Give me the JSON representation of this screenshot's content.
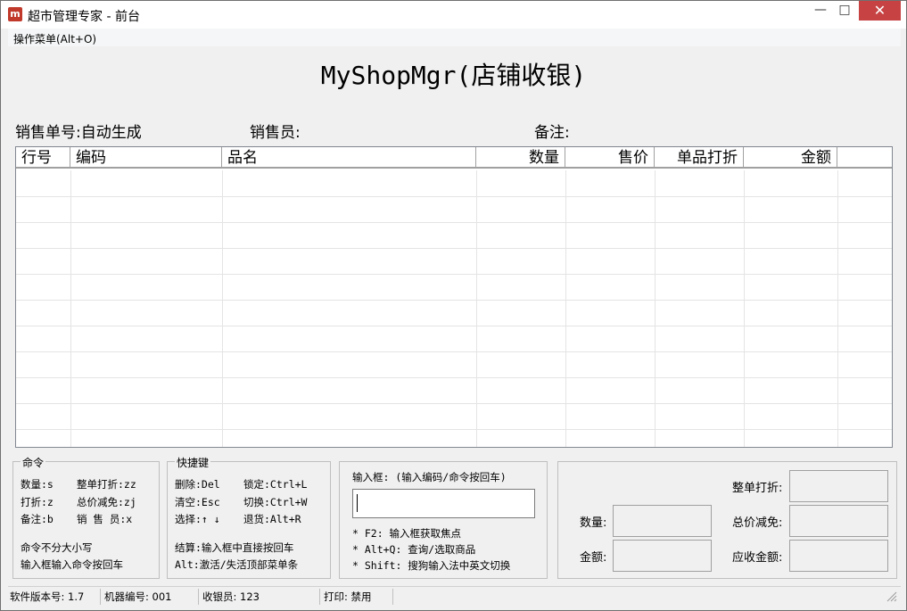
{
  "window": {
    "title": "超市管理专家 - 前台",
    "app_icon_glyph": "m",
    "minimize_glyph": "—",
    "maximize_glyph": "□",
    "close_glyph": "✕"
  },
  "menu": {
    "operations_label": "操作菜单(Alt+O)"
  },
  "header": {
    "app_title": "MyShopMgr(店铺收银)"
  },
  "fields": {
    "sale_no": "销售单号:自动生成",
    "salesperson": "销售员:",
    "remark": "备注:"
  },
  "grid": {
    "columns": [
      "行号",
      "编码",
      "品名",
      "数量",
      "售价",
      "单品打折",
      "金额"
    ]
  },
  "commands": {
    "title": "命令",
    "row1_a": "数量:s",
    "row1_b": "整单打折:zz",
    "row2_a": "打折:z",
    "row2_b": "总价减免:zj",
    "row3_a": "备注:b",
    "row3_b": "销 售 员:x",
    "note1": "命令不分大小写",
    "note2": "输入框输入命令按回车"
  },
  "shortcuts": {
    "title": "快捷键",
    "row1_a": "删除:Del",
    "row1_b": "锁定:Ctrl+L",
    "row2_a": "清空:Esc",
    "row2_b": "切换:Ctrl+W",
    "row3_a": "选择:↑ ↓",
    "row3_b": "退货:Alt+R",
    "note1": "结算:输入框中直接按回车",
    "note2": "Alt:激活/失活顶部菜单条"
  },
  "input_panel": {
    "label": "输入框: (输入编码/命令按回车)",
    "value": "",
    "hint1": "* F2: 输入框获取焦点",
    "hint2": "* Alt+Q: 查询/选取商品",
    "hint3": "* Shift: 搜狗输入法中英文切换"
  },
  "summary": {
    "quantity_label": "数量:",
    "amount_label": "金额:",
    "whole_discount_label": "整单打折:",
    "total_reduction_label": "总价减免:",
    "receivable_label": "应收金额:"
  },
  "status": {
    "version": "软件版本号: 1.7",
    "machine": "机器编号: 001",
    "cashier": "收银员: 123",
    "print": "打印: 禁用"
  }
}
